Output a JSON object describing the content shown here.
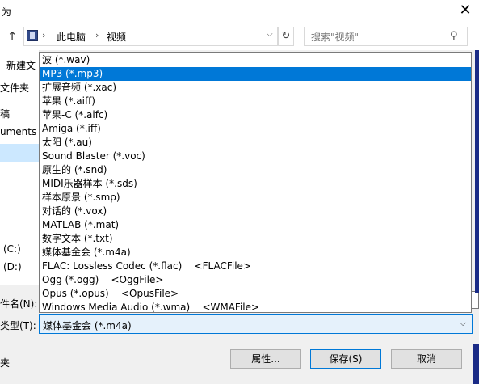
{
  "window": {
    "title": "为",
    "close_glyph": "✕"
  },
  "nav": {
    "up_glyph": "↑",
    "breadcrumb": [
      "此电脑",
      "视频"
    ],
    "breadcrumb_sep": "›",
    "dropdown_glyph": "⌵",
    "refresh_glyph": "↻",
    "search_placeholder": "搜索\"视频\"",
    "search_glyph": "⚲"
  },
  "toolbar": {
    "new_folder_label": "新建文"
  },
  "sidebar": {
    "items": [
      "文件夹",
      "稿",
      "uments",
      "(C:)",
      "(D:)"
    ]
  },
  "bottom": {
    "filename_label": "件名(N):",
    "filetype_label": "类型(T):",
    "folder_label": "夹"
  },
  "file_type_dropdown": {
    "selected_value": "媒体基金会 (*.m4a)",
    "arrow_glyph": "⌵",
    "options": [
      "波 (*.wav)",
      "MP3 (*.mp3)",
      "扩展音频 (*.xac)",
      "苹果 (*.aiff)",
      "苹果-C (*.aifc)",
      "Amiga (*.iff)",
      "太阳 (*.au)",
      "Sound Blaster (*.voc)",
      "原生的 (*.snd)",
      "MIDI乐器样本 (*.sds)",
      "样本原景 (*.smp)",
      "对话的 (*.vox)",
      "MATLAB (*.mat)",
      "数字文本 (*.txt)",
      "媒体基金会 (*.m4a)",
      "FLAC: Lossless Codec (*.flac)    <FLACFile>",
      "Ogg (*.ogg)    <OggFile>",
      "Opus (*.opus)    <OpusFile>",
      "Windows Media Audio (*.wma)    <WMAFile>"
    ],
    "highlighted_index": 1
  },
  "buttons": {
    "properties": "属性...",
    "save": "保存(S)",
    "cancel": "取消"
  },
  "colors": {
    "selection": "#0078d7",
    "selection_text": "#ffffff",
    "focus_fill": "#e5f1fb"
  }
}
